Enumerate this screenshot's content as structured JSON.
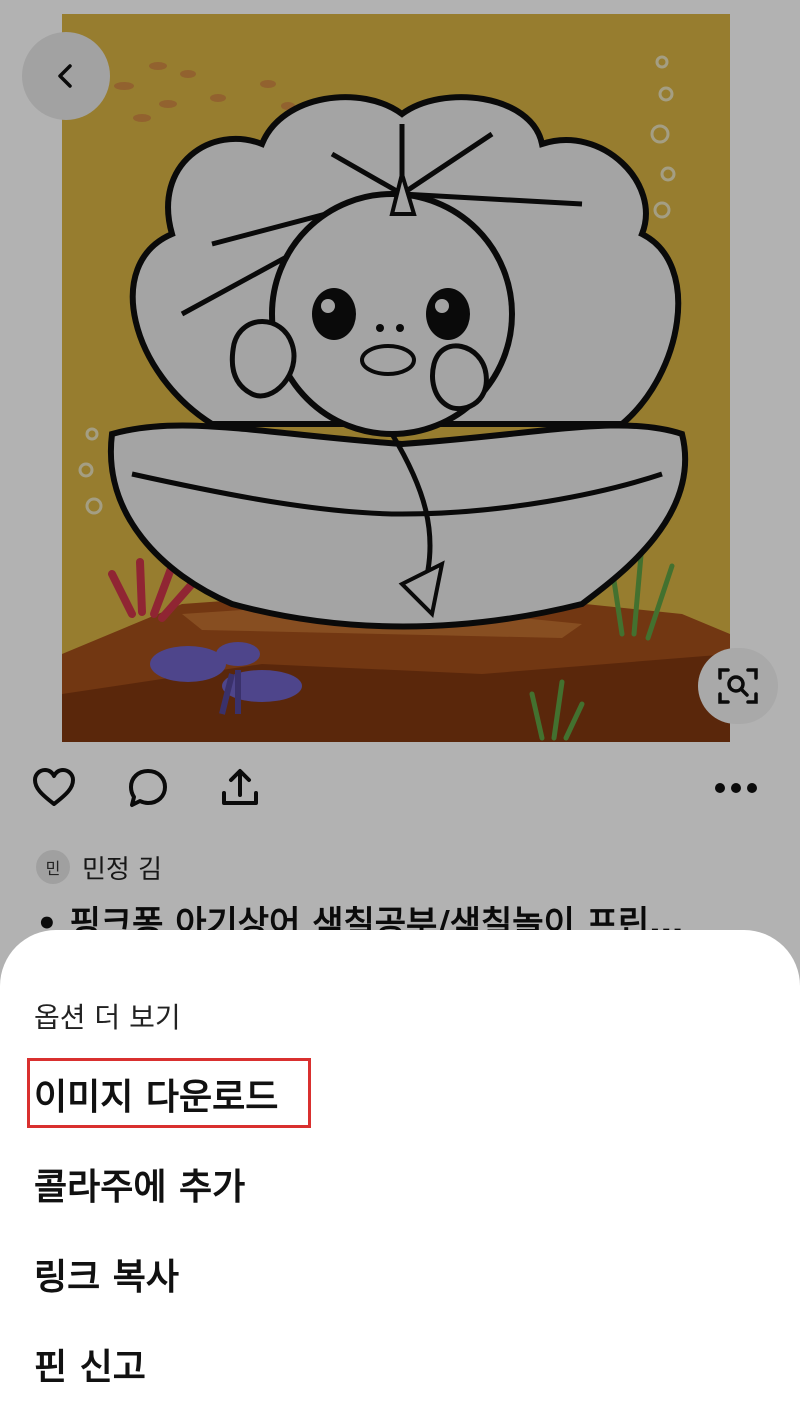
{
  "pin": {
    "author_initial": "민",
    "author_name": "민정 김",
    "title": "• 핑크퐁 아기상어 색칠공부/색칠놀이 프린…"
  },
  "icons": {
    "back": "chevron-left-icon",
    "visual_search": "visual-search-icon",
    "like": "heart-icon",
    "comment": "comment-bubble-icon",
    "share": "share-upload-icon",
    "more": "more-dots-icon"
  },
  "sheet": {
    "heading": "옵션 더 보기",
    "items": [
      {
        "label": "이미지 다운로드",
        "highlighted": true
      },
      {
        "label": "콜라주에 추가"
      },
      {
        "label": "링크 복사"
      },
      {
        "label": "핀 신고"
      }
    ]
  },
  "colors": {
    "highlight": "#d9302f",
    "image_background": "#ecc44a",
    "overlay": "rgba(0,0,0,0.30)"
  }
}
